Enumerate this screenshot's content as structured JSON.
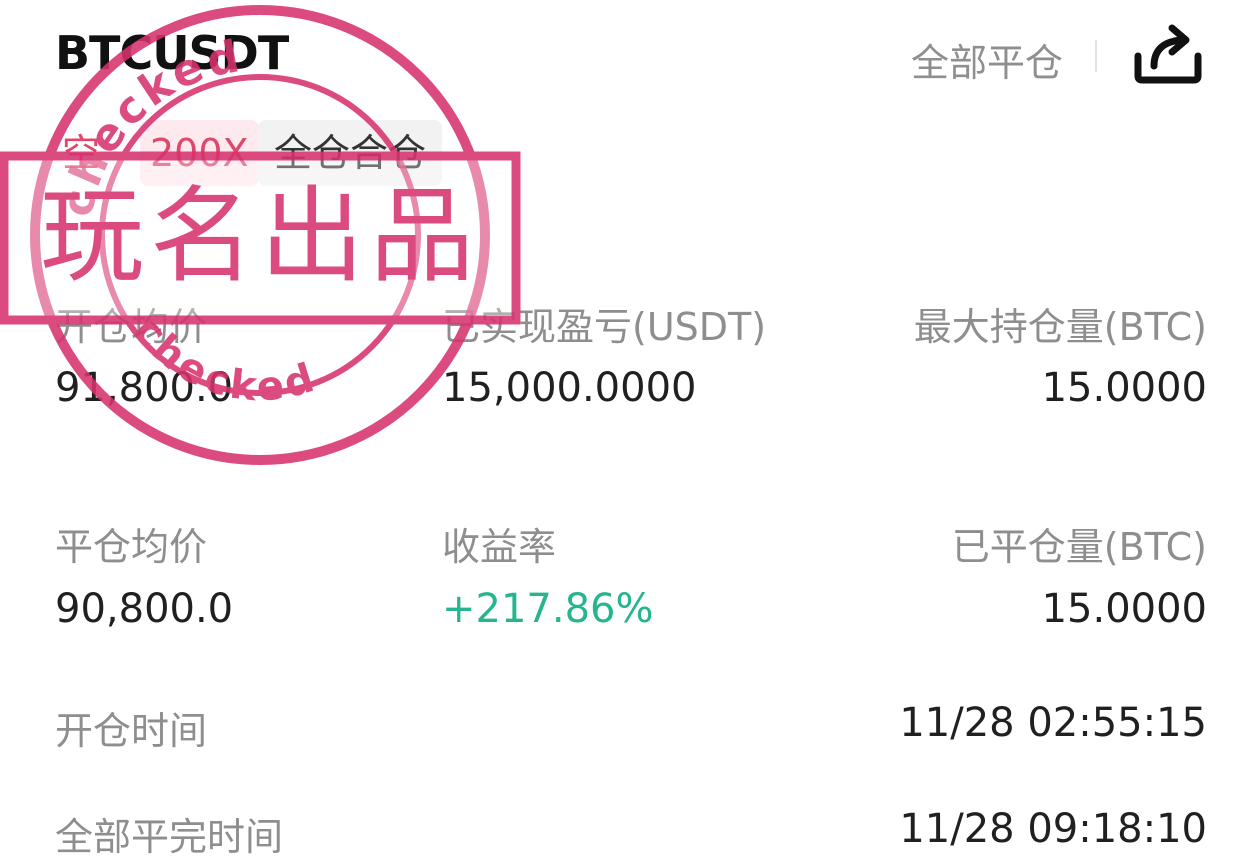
{
  "header": {
    "symbol": "BTCUSDT",
    "close_all_label": "全部平仓",
    "share_icon": "share-icon"
  },
  "tags": {
    "side": "空",
    "leverage": "200X",
    "margin_mode": "全仓合仓"
  },
  "stats": {
    "row1": {
      "open_avg_price": {
        "label": "开仓均价",
        "value": "91,800.0"
      },
      "realized_pnl": {
        "label": "已实现盈亏(USDT)",
        "value": "15,000.0000"
      },
      "max_position": {
        "label": "最大持仓量(BTC)",
        "value": "15.0000"
      }
    },
    "row2": {
      "close_avg_price": {
        "label": "平仓均价",
        "value": "90,800.0"
      },
      "roi": {
        "label": "收益率",
        "value": "+217.86%"
      },
      "closed_volume": {
        "label": "已平仓量(BTC)",
        "value": "15.0000"
      }
    },
    "open_time": {
      "label": "开仓时间",
      "value": "11/28 02:55:15"
    },
    "close_time": {
      "label": "全部平完时间",
      "value": "11/28 09:18:10"
    }
  },
  "stamp": {
    "main_text": "玩名出品",
    "ring_text": "checked",
    "color": "#d8336f"
  },
  "colors": {
    "profit": "#27b58f",
    "short": "#e0486b",
    "label": "#8e8e8e"
  }
}
